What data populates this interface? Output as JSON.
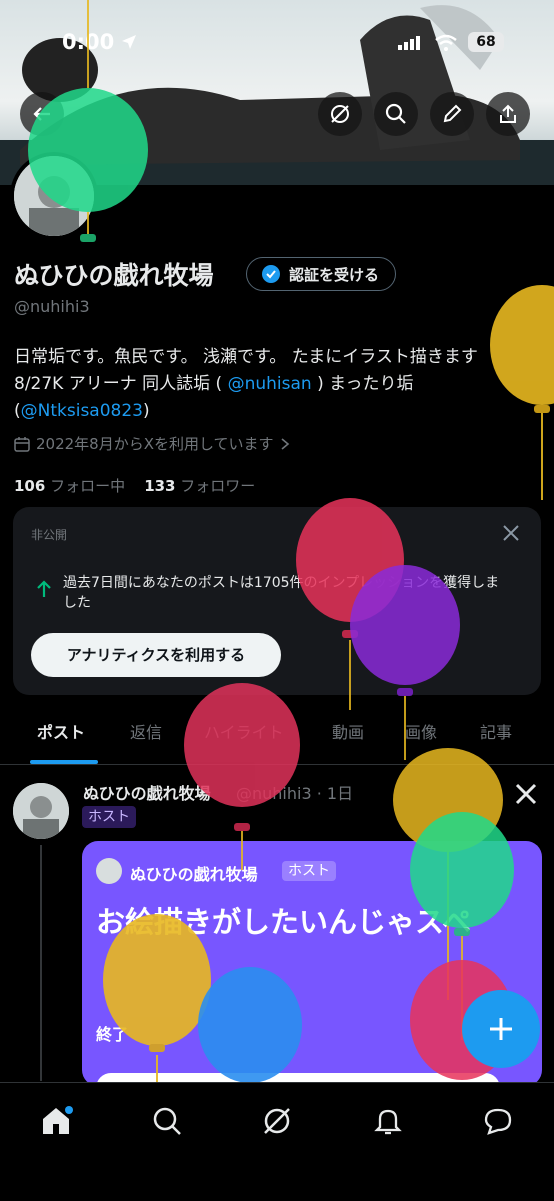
{
  "status_bar": {
    "time": "0:00",
    "battery": "68"
  },
  "profile": {
    "name": "ぬひひの戯れ牧場",
    "verify_label": "認証を受ける",
    "handle": "@nuhihi3",
    "bio_line1": "日常垢です。魚民です。 浅瀬です。 たまにイラスト描きます",
    "bio_line2_a": "8/27K アリーナ 同人誌垢 ( ",
    "bio_link1": "@nuhisan",
    "bio_line2_b": " ) まったり垢",
    "bio_line3_a": "(",
    "bio_link2": "@Ntksisa0823",
    "bio_line3_b": ")",
    "joined": "2022年8月からXを利用しています",
    "following_count": "106",
    "following_label": "フォロー中",
    "followers_count": "133",
    "followers_label": "フォロワー"
  },
  "analytics_card": {
    "privacy": "非公開",
    "message": "過去7日間にあなたのポストは1705件のインプレッションを獲得しました",
    "button": "アナリティクスを利用する"
  },
  "tabs": [
    "ポスト",
    "返信",
    "ハイライト",
    "動画",
    "画像",
    "記事"
  ],
  "post": {
    "author": "ぬひひの戯れ牧場",
    "meta": "@nuhihi3 · 1日",
    "badge": "ホスト",
    "space": {
      "host_name": "ぬひひの戯れ牧場",
      "host_badge": "ホスト",
      "title": "お絵描きがしたいんじゃスペ",
      "status": "終了"
    }
  },
  "colors": {
    "accent": "#1d9bf0",
    "space_purple": "#7856ff",
    "background": "#000000"
  },
  "icons": [
    "back-arrow-icon",
    "grok-icon",
    "search-icon",
    "edit-pencil-icon",
    "share-icon",
    "verified-badge-icon",
    "calendar-icon",
    "trend-up-icon",
    "close-icon",
    "x-logo-icon",
    "plus-icon",
    "home-icon",
    "search-icon",
    "grok-icon",
    "bell-icon",
    "message-icon"
  ]
}
